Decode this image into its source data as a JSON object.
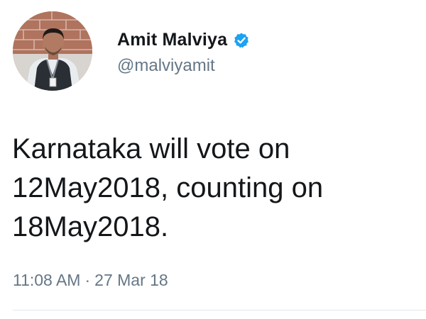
{
  "author": {
    "display_name": "Amit Malviya",
    "handle": "@malviyamit",
    "verified_icon": "verified-badge-icon",
    "verified_color": "#1da1f2"
  },
  "tweet": {
    "lines": [
      "Karnataka will vote on",
      "12May2018, counting on",
      "18May2018."
    ],
    "time": "11:08 AM",
    "separator": "·",
    "date": "27 Mar 18"
  },
  "colors": {
    "text": "#14171a",
    "secondary": "#657786",
    "divider": "#e1e8ed"
  }
}
